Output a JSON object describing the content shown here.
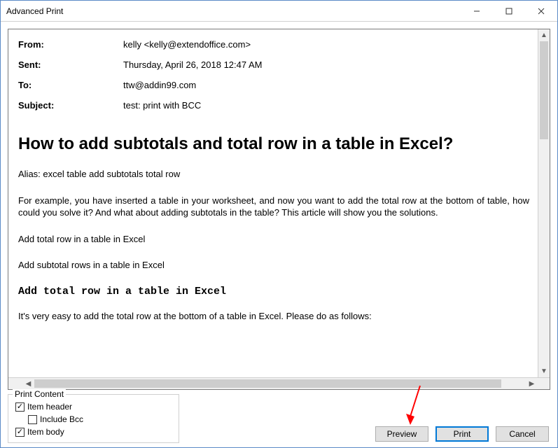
{
  "window": {
    "title": "Advanced Print"
  },
  "email": {
    "from_label": "From:",
    "from_value": "kelly <kelly@extendoffice.com>",
    "sent_label": "Sent:",
    "sent_value": "Thursday, April 26, 2018 12:47 AM",
    "to_label": "To:",
    "to_value": "ttw@addin99.com",
    "subject_label": "Subject:",
    "subject_value": "test: print with BCC"
  },
  "body": {
    "title": "How to add subtotals and total row in a table in Excel?",
    "alias": "Alias: excel table add subtotals total row",
    "para1": "For example, you have inserted a table in your worksheet, and now you want to add the total row at the bottom of table, how could you solve it? And what about adding subtotals in the table? This article will show you the solutions.",
    "link1": "Add total row in a table in Excel",
    "link2": "Add subtotal rows in a table in Excel",
    "heading2": "Add total row in a table in Excel",
    "para2": "It's very easy to add the total row at the bottom of a table in Excel. Please do as follows:"
  },
  "group": {
    "legend": "Print Content",
    "item_header": "Item header",
    "include_bcc": "Include Bcc",
    "item_body": "Item body"
  },
  "buttons": {
    "preview": "Preview",
    "print": "Print",
    "cancel": "Cancel"
  }
}
